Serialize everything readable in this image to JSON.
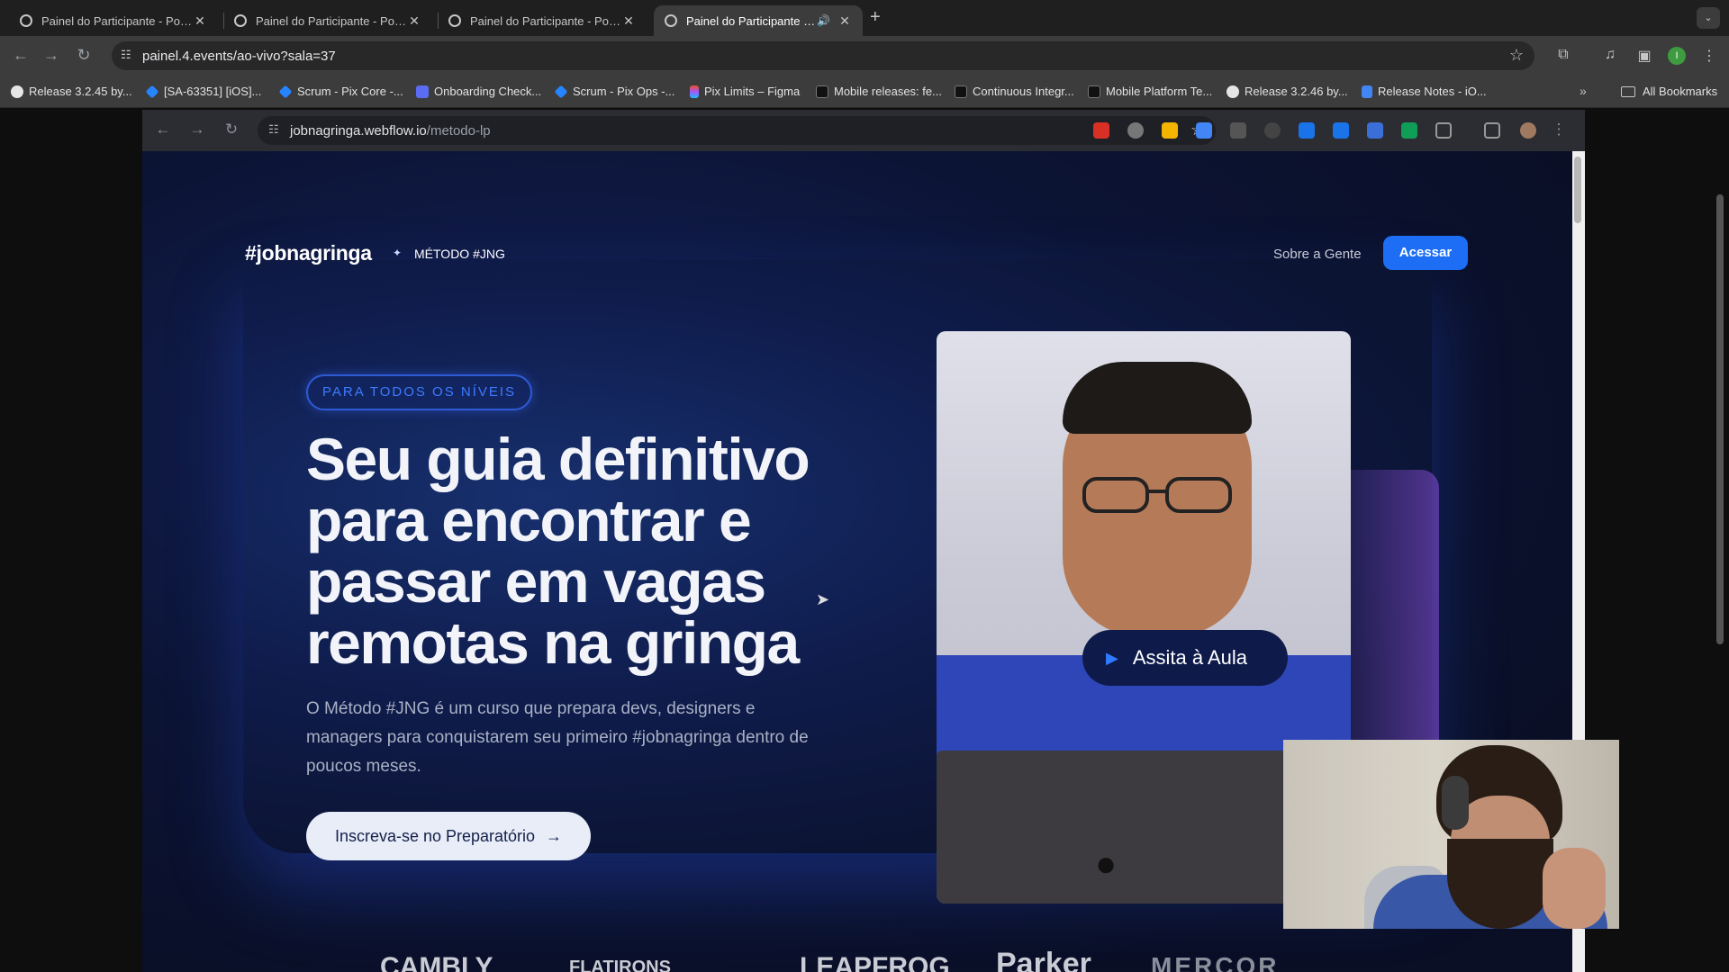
{
  "browser": {
    "tabs": [
      {
        "title": "Painel do Participante - Power"
      },
      {
        "title": "Painel do Participante - Power"
      },
      {
        "title": "Painel do Participante - Power"
      },
      {
        "title": "Painel do Participante - Power",
        "active": true,
        "audio": true
      }
    ],
    "url": "painel.4.events/ao-vivo?sala=37",
    "profile_initial": "I",
    "bookmarks": [
      {
        "label": "Release 3.2.45 by...",
        "icon": "github-icon"
      },
      {
        "label": "[SA-63351] [iOS]...",
        "icon": "jira-icon"
      },
      {
        "label": "Scrum - Pix Core -...",
        "icon": "jira-icon"
      },
      {
        "label": "Onboarding Check...",
        "icon": "clickup-icon"
      },
      {
        "label": "Scrum - Pix Ops -...",
        "icon": "jira-icon"
      },
      {
        "label": "Pix Limits – Figma",
        "icon": "figma-icon"
      },
      {
        "label": "Mobile releases: fe...",
        "icon": "bitrise-icon"
      },
      {
        "label": "Continuous Integr...",
        "icon": "bitrise-icon"
      },
      {
        "label": "Mobile Platform Te...",
        "icon": "bitrise-icon"
      },
      {
        "label": "Release 3.2.46 by...",
        "icon": "github-icon"
      },
      {
        "label": "Release Notes - iO...",
        "icon": "docs-icon"
      }
    ],
    "all_bookmarks": "All Bookmarks"
  },
  "inner_browser": {
    "url_domain": "jobnagringa.webflow.io",
    "url_path": "/metodo-lp"
  },
  "site": {
    "logo": "#jobnagringa",
    "logo_separator": "✦",
    "product": "MÉTODO #JNG",
    "nav_about": "Sobre a Gente",
    "nav_access": "Acessar",
    "badge": "PARA TODOS OS NÍVEIS",
    "headline": "Seu guia definitivo para encontrar e passar em vagas remotas na gringa",
    "subtitle": "O Método #JNG é um curso que prepara devs, designers e managers para conquistarem seu primeiro #jobnagringa dentro de poucos meses.",
    "cta": "Inscreva-se no Preparatório",
    "cta_arrow": "→",
    "video_cta": "Assita à Aula",
    "logos": [
      "CAMBLY",
      "FLATIRONS",
      "LEAPFROG",
      "Parker",
      "MERCOR"
    ]
  },
  "colors": {
    "accent_blue": "#1d6ef5",
    "page_bg": "#0c1435"
  }
}
